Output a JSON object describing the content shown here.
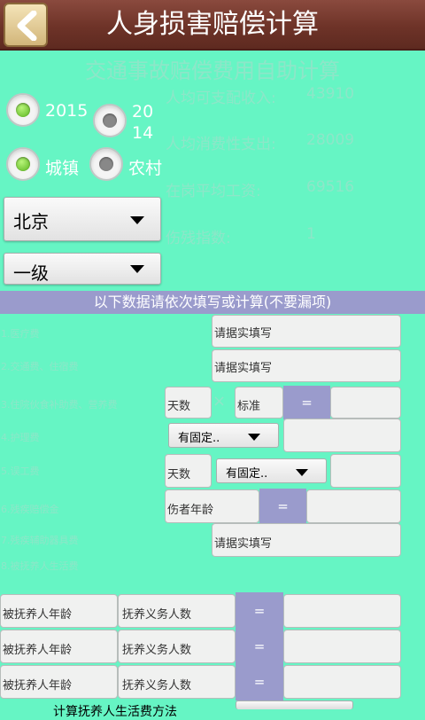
{
  "header": {
    "title": "人身损害赔偿计算"
  },
  "subtitle": "交通事故赔偿费用自助计算",
  "year_options": [
    "2015",
    "2014"
  ],
  "area_options": [
    "城镇",
    "农村"
  ],
  "info": [
    {
      "label": "人均可支配收入:",
      "value": "43910"
    },
    {
      "label": "人均消费性支出:",
      "value": "28009"
    },
    {
      "label": "在岗平均工资:",
      "value": "69516"
    },
    {
      "label": "伤残指数:",
      "value": "1"
    }
  ],
  "region_select": "北京",
  "grade_select": "一级",
  "section_title": "以下数据请依次填写或计算(不要漏项)",
  "items": [
    "1.医疗费",
    "2.交通费、住宿费",
    "3.住院伙食补助费、营养费",
    "4.护理费",
    "5.误工费",
    "6.残疾赔偿金",
    "7.残疾辅助器具费",
    "8.被抚养人生活费"
  ],
  "placeholders": {
    "actual": "请据实填写",
    "days": "天数",
    "standard": "标准",
    "fixed": "有固定..",
    "victim_age": "伤者年龄",
    "dependent_age": "被抚养人年龄",
    "obligors": "抚养义务人数"
  },
  "equals": "=",
  "times": "×",
  "bottom_button": "计算抚养人生活费方法"
}
